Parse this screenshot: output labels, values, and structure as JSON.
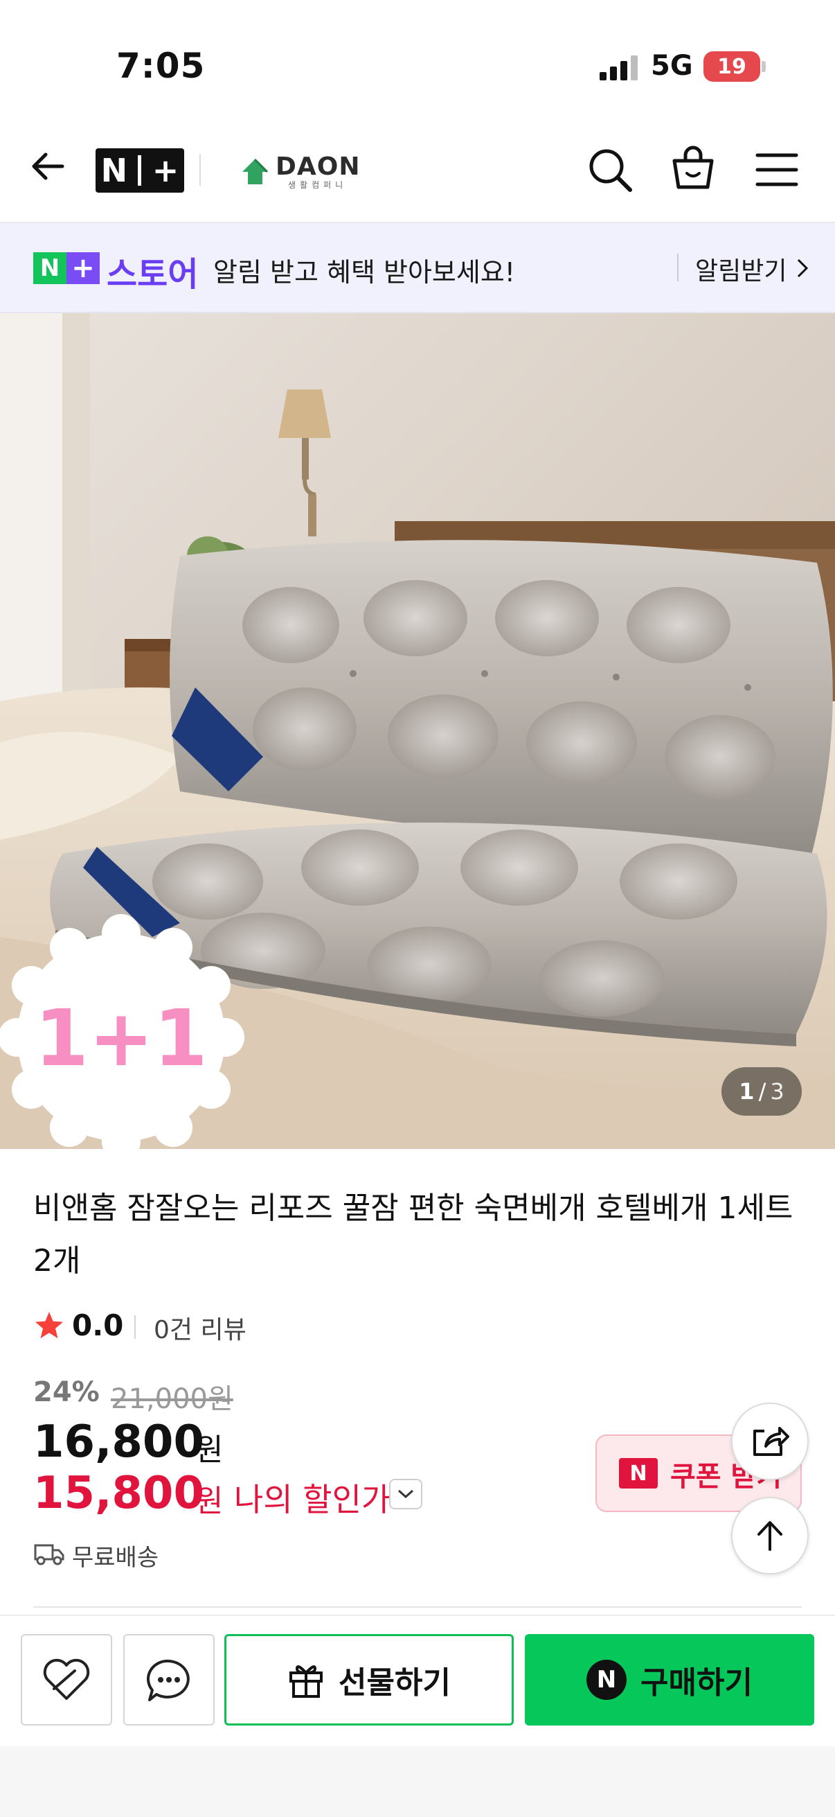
{
  "status_bar": {
    "time": "7:05",
    "network": "5G",
    "battery": "19"
  },
  "header": {
    "nplus_logo": "N+",
    "brand_logo": "DAON",
    "brand_logo_sub": "생활컴퍼니"
  },
  "promo": {
    "logo_n": "N",
    "logo_plus": "+",
    "store_label": "스토어",
    "message": "알림 받고 혜택 받아보세요!",
    "action_label": "알림받기"
  },
  "product_image": {
    "badge": "1+1",
    "counter_current": "1",
    "counter_sep": "/",
    "counter_total": "3"
  },
  "product": {
    "title": "비앤홈 잠잘오는 리포즈 꿀잠 편한 숙면베개 호텔베개 1세트 2개",
    "rating": "0.0",
    "review_count": "0건 리뷰",
    "discount_rate": "24%",
    "original_price": "21,000원",
    "sale_price": "16,800",
    "sale_unit": "원",
    "my_price": "15,800",
    "my_unit": "원",
    "my_price_label": "나의 할인가",
    "shipping": "무료배송",
    "coupon_icon": "N",
    "coupon_label": "쿠폰 받기"
  },
  "bottom_bar": {
    "gift_label": "선물하기",
    "buy_icon": "N",
    "buy_label": "구매하기"
  },
  "colors": {
    "naver_green": "#05c75a",
    "plus_purple": "#7a4cf5",
    "price_red": "#e0143c",
    "promo_bg": "#f1f0fd"
  }
}
